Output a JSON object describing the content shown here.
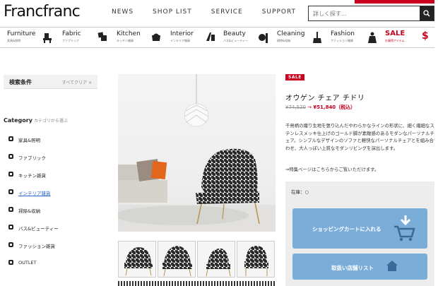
{
  "header": {
    "logo": "Francfranc",
    "nav": [
      "NEWS",
      "SHOP LIST",
      "SERVICE",
      "SUPPORT"
    ],
    "search_placeholder": "詳しく探す..."
  },
  "categories": [
    {
      "en": "Furniture",
      "jp": "家具&照明",
      "icon": "chair-icon"
    },
    {
      "en": "Fabric",
      "jp": "ファブリック",
      "icon": "cushion-icon"
    },
    {
      "en": "Kitchen",
      "jp": "キッチン雑貨",
      "icon": "pot-icon"
    },
    {
      "en": "Interior",
      "jp": "インテリア雑貨",
      "icon": "interior-icon"
    },
    {
      "en": "Beauty",
      "jp": "バス&ビューティー",
      "icon": "bottle-icon"
    },
    {
      "en": "Cleaning",
      "jp": "掃除&収納",
      "icon": "broom-icon"
    },
    {
      "en": "Fashion",
      "jp": "ファッション雑貨",
      "icon": "shirt-icon"
    },
    {
      "en": "SALE",
      "jp": "お買得アイテム",
      "icon": "dollar-icon"
    }
  ],
  "sidebar": {
    "title": "検索条件",
    "clear": "すべてクリア ×",
    "category_title": "Category",
    "category_sub": "カテゴリから選ぶ",
    "items": [
      {
        "label": "家具&照明",
        "active": false
      },
      {
        "label": "ファブリック",
        "active": false
      },
      {
        "label": "キッチン雑貨",
        "active": false
      },
      {
        "label": "インテリア雑貨",
        "active": true
      },
      {
        "label": "掃除&収納",
        "active": false
      },
      {
        "label": "バス&ビューティー",
        "active": false
      },
      {
        "label": "ファッション雑貨",
        "active": false
      },
      {
        "label": "OUTLET",
        "active": false
      }
    ]
  },
  "product": {
    "badge": "SALE",
    "name": "オウゲン チェア チドリ",
    "old_price": "¥74,520",
    "arrow": "→",
    "new_price": "¥51,840（税込）",
    "description": "千鳥柄の織り生地を張り込んだやわらかなラインの形状に、細く繊細なステンレスメッキ仕上げのゴールド脚が素敵感のあるモダンなパーソナルチェア。シンプルなデザインのソファと軽快なパーソナルチェアとを組み合わせ、大人っぽい上質なモダンリビングを演出します。",
    "feature_link": "⇒特集ページはこちらからご覧いただけます。",
    "stock": "在庫：○",
    "cart_button": "ショッピングカートに入れる",
    "store_button": "取扱い店舗リスト"
  },
  "colors": {
    "accent": "#c8001e",
    "button": "#7aaed9",
    "link": "#2464c4"
  }
}
